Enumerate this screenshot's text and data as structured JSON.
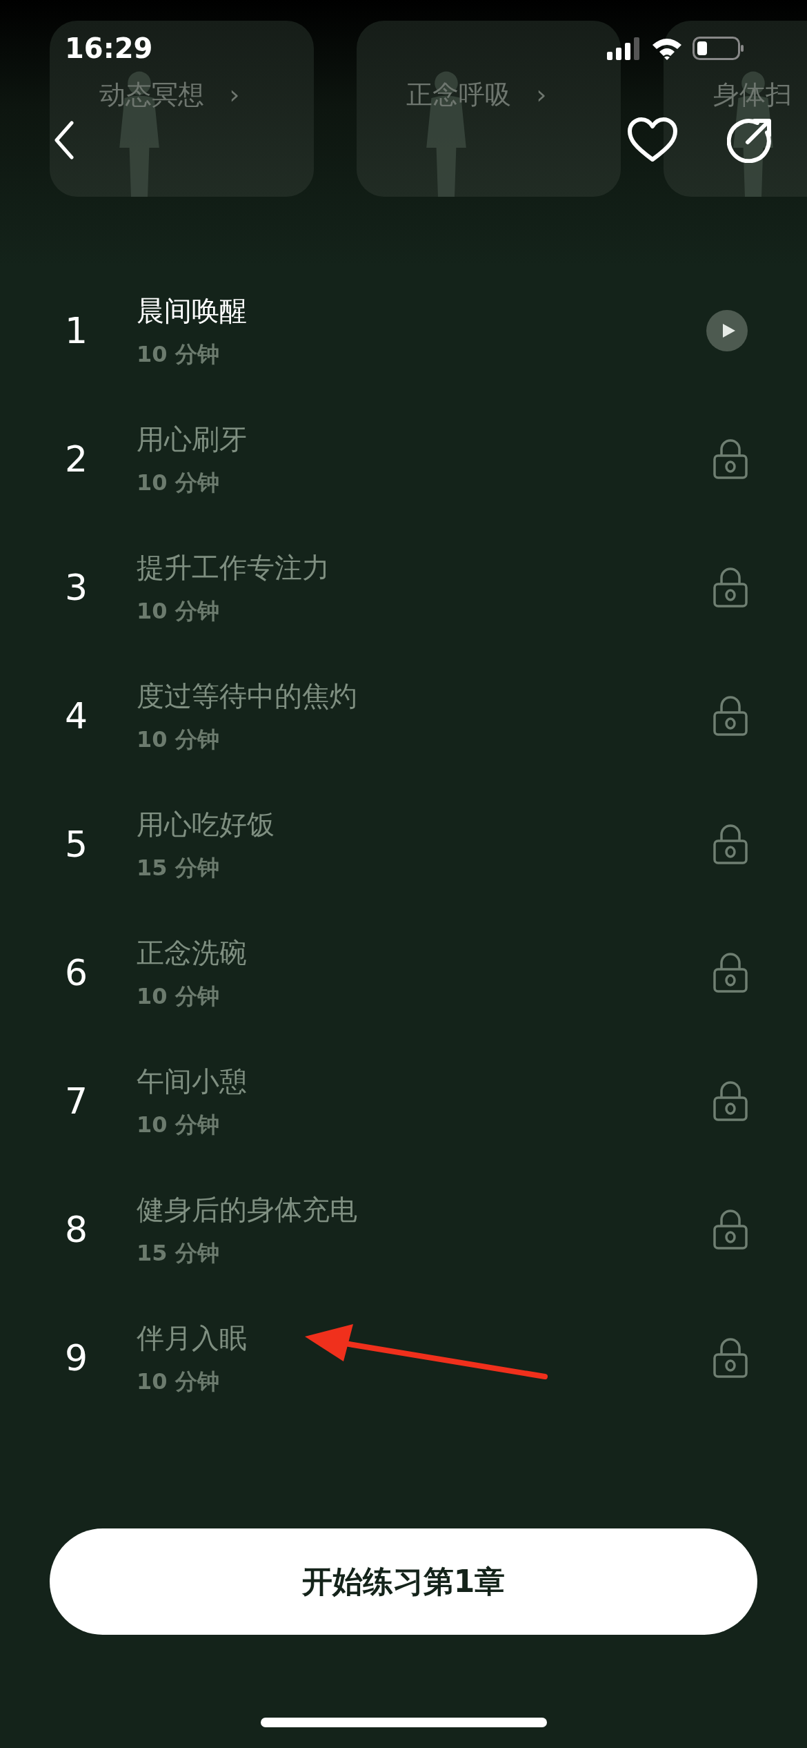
{
  "status_bar": {
    "time": "16:29"
  },
  "categories": [
    {
      "label": "动态冥想",
      "chevron": "›"
    },
    {
      "label": "正念呼吸",
      "chevron": "›"
    },
    {
      "label": "身体扫"
    }
  ],
  "lessons": [
    {
      "number": "1",
      "title": "晨间唤醒",
      "duration": "10 分钟",
      "locked": false
    },
    {
      "number": "2",
      "title": "用心刷牙",
      "duration": "10 分钟",
      "locked": true
    },
    {
      "number": "3",
      "title": "提升工作专注力",
      "duration": "10 分钟",
      "locked": true
    },
    {
      "number": "4",
      "title": "度过等待中的焦灼",
      "duration": "10 分钟",
      "locked": true
    },
    {
      "number": "5",
      "title": "用心吃好饭",
      "duration": "15 分钟",
      "locked": true
    },
    {
      "number": "6",
      "title": "正念洗碗",
      "duration": "10 分钟",
      "locked": true
    },
    {
      "number": "7",
      "title": "午间小憩",
      "duration": "10 分钟",
      "locked": true
    },
    {
      "number": "8",
      "title": "健身后的身体充电",
      "duration": "15 分钟",
      "locked": true
    },
    {
      "number": "9",
      "title": "伴月入眠",
      "duration": "10 分钟",
      "locked": true
    }
  ],
  "start_button": "开始练习第1章"
}
